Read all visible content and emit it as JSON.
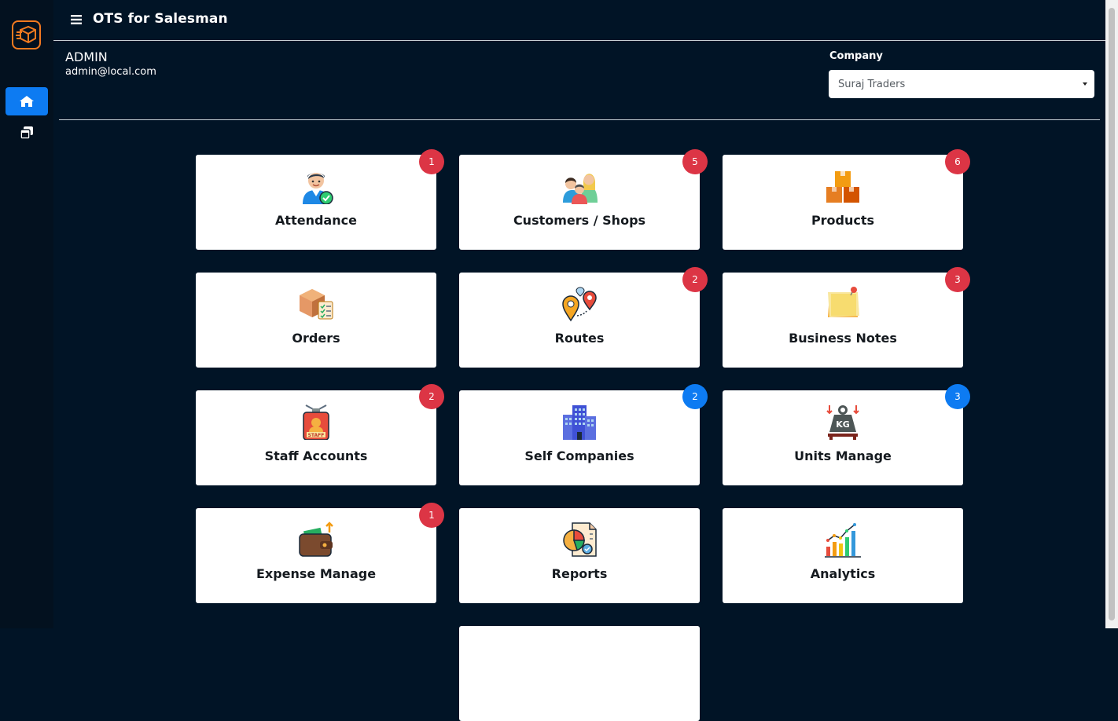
{
  "app": {
    "title": "OTS for Salesman"
  },
  "sidebar": {
    "logo_icon": "package-logo-icon",
    "items": [
      {
        "name": "home",
        "icon": "home-icon",
        "active": true
      },
      {
        "name": "pages",
        "icon": "stacked-pages-icon",
        "active": false
      }
    ]
  },
  "user": {
    "name": "ADMIN",
    "email": "admin@local.com"
  },
  "company": {
    "label": "Company",
    "selected": "Suraj Traders"
  },
  "tiles": [
    {
      "label": "Attendance",
      "icon": "attendance-person-icon",
      "badge": "1",
      "badge_color": "#dc3545"
    },
    {
      "label": "Customers / Shops",
      "icon": "customers-group-icon",
      "badge": "5",
      "badge_color": "#dc3545"
    },
    {
      "label": "Products",
      "icon": "boxes-icon",
      "badge": "6",
      "badge_color": "#dc3545"
    },
    {
      "label": "Orders",
      "icon": "order-box-checklist-icon",
      "badge": "",
      "badge_color": ""
    },
    {
      "label": "Routes",
      "icon": "route-pins-icon",
      "badge": "2",
      "badge_color": "#dc3545"
    },
    {
      "label": "Business Notes",
      "icon": "sticky-note-icon",
      "badge": "3",
      "badge_color": "#dc3545"
    },
    {
      "label": "Staff Accounts",
      "icon": "staff-id-card-icon",
      "badge": "2",
      "badge_color": "#dc3545"
    },
    {
      "label": "Self Companies",
      "icon": "office-building-icon",
      "badge": "2",
      "badge_color": "#0d7bf2"
    },
    {
      "label": "Units Manage",
      "icon": "kg-weight-icon",
      "badge": "3",
      "badge_color": "#0d7bf2"
    },
    {
      "label": "Expense Manage",
      "icon": "wallet-icon",
      "badge": "1",
      "badge_color": "#dc3545"
    },
    {
      "label": "Reports",
      "icon": "report-pie-icon",
      "badge": "",
      "badge_color": ""
    },
    {
      "label": "Analytics",
      "icon": "bar-chart-icon",
      "badge": "",
      "badge_color": ""
    }
  ],
  "colors": {
    "background": "#011426",
    "accent": "#0d7bf2",
    "badge_red": "#dc3545"
  }
}
